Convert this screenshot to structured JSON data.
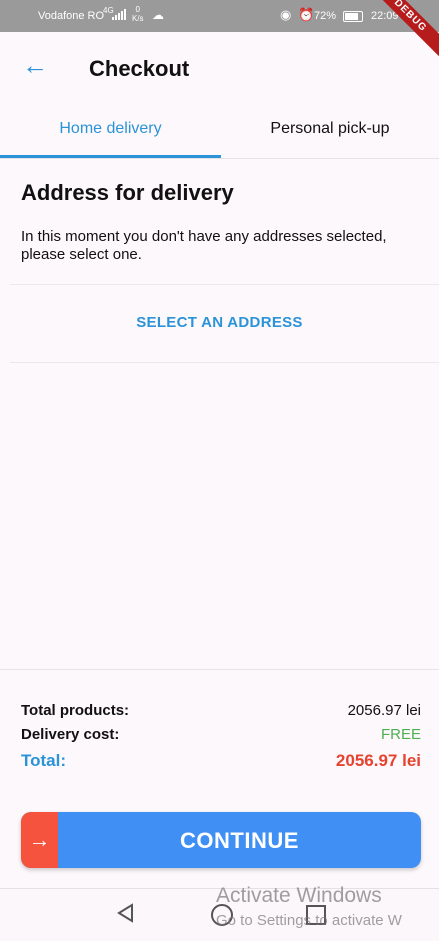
{
  "status_bar": {
    "carrier": "Vodafone RO",
    "network": "4G",
    "speed_value": "0",
    "speed_unit": "K/s",
    "battery": "72%",
    "battery_level": 0.72,
    "time": "22:09"
  },
  "debug_banner": "DEBUG",
  "appbar": {
    "title": "Checkout"
  },
  "tabs": [
    {
      "label": "Home delivery",
      "selected": true
    },
    {
      "label": "Personal pick-up",
      "selected": false
    }
  ],
  "address": {
    "title": "Address for delivery",
    "description": "In this moment you don't have any addresses selected, please select one.",
    "select_label": "SELECT AN ADDRESS"
  },
  "summary": {
    "products_label": "Total products:",
    "products_value": "2056.97 lei",
    "delivery_label": "Delivery cost:",
    "delivery_value": "FREE",
    "total_label": "Total:",
    "total_value": "2056.97 lei"
  },
  "continue_label": "CONTINUE",
  "watermark": {
    "line1": "Activate Windows",
    "line2": "Go to Settings to activate W"
  },
  "colors": {
    "accent": "#2b93d8",
    "button": "#3f8ff5",
    "button_accent": "#f5533d",
    "total": "#e5432f",
    "free": "#4caf50"
  }
}
